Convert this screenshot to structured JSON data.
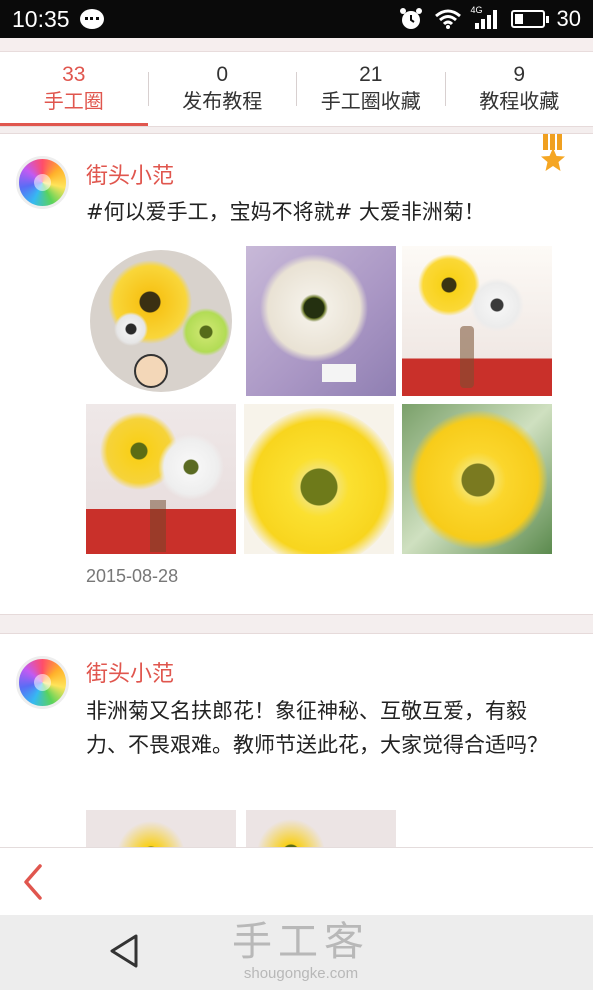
{
  "status_bar": {
    "time": "10:35",
    "network": "4G",
    "battery_level": "30",
    "battery_fraction": 0.3,
    "icons": [
      "message-icon",
      "alarm-icon",
      "wifi-icon",
      "signal-icon",
      "battery-icon"
    ]
  },
  "tabs": [
    {
      "count": "33",
      "label": "手工圈",
      "active": true
    },
    {
      "count": "0",
      "label": "发布教程",
      "active": false
    },
    {
      "count": "21",
      "label": "手工圈收藏",
      "active": false
    },
    {
      "count": "9",
      "label": "教程收藏",
      "active": false
    }
  ],
  "posts": [
    {
      "author": "街头小范",
      "text": "#何以爱手工，宝妈不将就# 大爱非洲菊！",
      "date": "2015-08-28",
      "has_medal": true
    },
    {
      "author": "街头小范",
      "text": "非洲菊又名扶郎花！象征神秘、互敬互爱，有毅力、不畏艰难。教师节送此花，大家觉得合适吗？"
    }
  ],
  "bottom": {
    "back_icon": "chevron-left-icon"
  },
  "nav": {
    "back_icon": "triangle-back-icon"
  },
  "watermark": {
    "title": "手工客",
    "url": "shougongke.com"
  },
  "colors": {
    "accent": "#e0564e",
    "background": "#f2eded",
    "flower_yellow": "#f7d21a"
  }
}
